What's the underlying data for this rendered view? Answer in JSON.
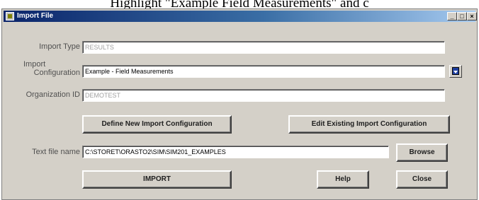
{
  "caption": "Highlight \"Example Field Measurements\" and c",
  "window": {
    "title": "Import File",
    "controls": {
      "minimize": "_",
      "maximize": "□",
      "close": "×"
    }
  },
  "form": {
    "import_type": {
      "label": "Import Type",
      "value": "RESULTS"
    },
    "import_configuration": {
      "label_line1": "Import",
      "label_line2": "Configuration",
      "value": "Example - Field Measurements"
    },
    "organization_id": {
      "label": "Organization ID",
      "value": "DEMOTEST"
    },
    "text_file_name": {
      "label": "Text file name",
      "value": "C:\\STORET\\ORASTO2\\SIM\\SIM201_EXAMPLES"
    }
  },
  "buttons": {
    "define_new": "Define New Import Configuration",
    "edit_existing": "Edit Existing Import Configuration",
    "browse": "Browse",
    "import": "IMPORT",
    "help": "Help",
    "close": "Close"
  }
}
